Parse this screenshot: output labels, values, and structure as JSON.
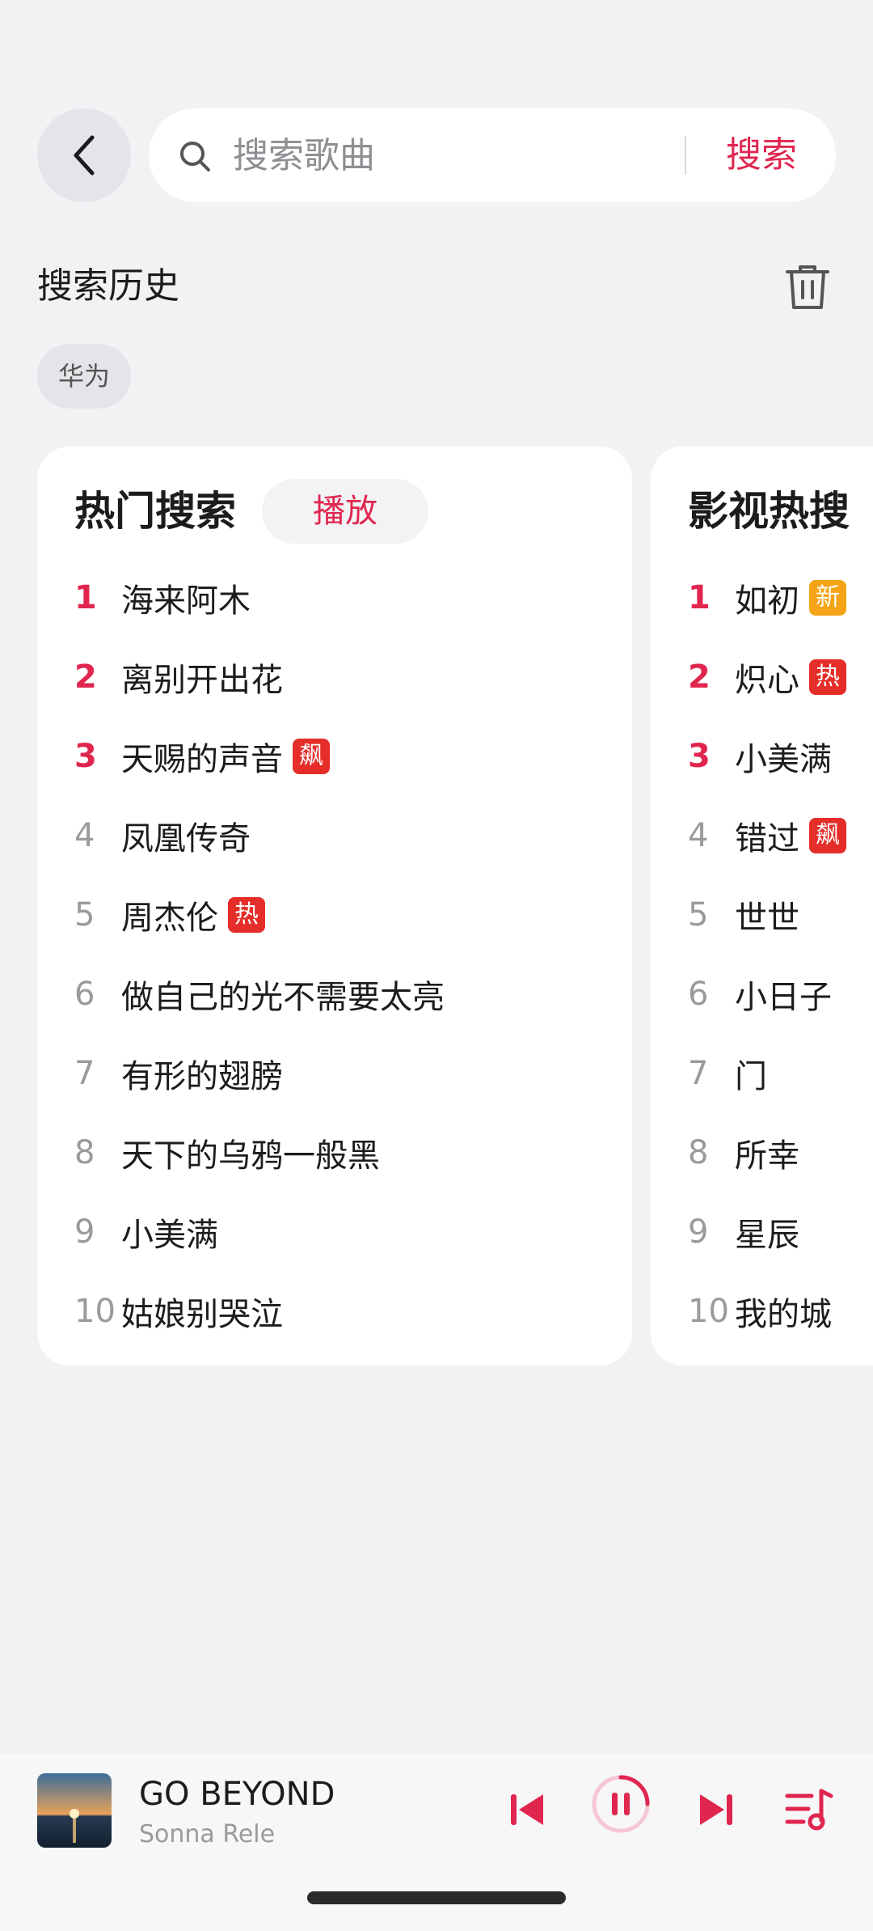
{
  "search": {
    "placeholder": "搜索歌曲",
    "submit_label": "搜索"
  },
  "history": {
    "title": "搜索历史",
    "items": [
      "华为"
    ]
  },
  "hot_search": {
    "title": "热门搜索",
    "play_label": "播放",
    "items": [
      {
        "rank": "1",
        "title": "海来阿木",
        "tag": ""
      },
      {
        "rank": "2",
        "title": "离别开出花",
        "tag": ""
      },
      {
        "rank": "3",
        "title": "天赐的声音",
        "tag": "飙"
      },
      {
        "rank": "4",
        "title": "凤凰传奇",
        "tag": ""
      },
      {
        "rank": "5",
        "title": "周杰伦",
        "tag": "热"
      },
      {
        "rank": "6",
        "title": "做自己的光不需要太亮",
        "tag": ""
      },
      {
        "rank": "7",
        "title": "有形的翅膀",
        "tag": ""
      },
      {
        "rank": "8",
        "title": "天下的乌鸦一般黑",
        "tag": ""
      },
      {
        "rank": "9",
        "title": "小美满",
        "tag": ""
      },
      {
        "rank": "10",
        "title": "姑娘别哭泣",
        "tag": ""
      }
    ]
  },
  "film_search": {
    "title": "影视热搜",
    "items": [
      {
        "rank": "1",
        "title": "如初",
        "tag": "新"
      },
      {
        "rank": "2",
        "title": "炽心",
        "tag": "热"
      },
      {
        "rank": "3",
        "title": "小美满",
        "tag": ""
      },
      {
        "rank": "4",
        "title": "错过",
        "tag": "飙"
      },
      {
        "rank": "5",
        "title": "世世",
        "tag": ""
      },
      {
        "rank": "6",
        "title": "小日子",
        "tag": ""
      },
      {
        "rank": "7",
        "title": "门",
        "tag": ""
      },
      {
        "rank": "8",
        "title": "所幸",
        "tag": ""
      },
      {
        "rank": "9",
        "title": "星辰",
        "tag": ""
      },
      {
        "rank": "10",
        "title": "我的城",
        "tag": ""
      }
    ]
  },
  "player": {
    "song_title": "GO BEYOND",
    "artist": "Sonna Rele"
  },
  "colors": {
    "accent": "#e0264f",
    "tag_red": "#e52e2a",
    "tag_new": "#f4a416",
    "background": "#f1f2f4"
  },
  "icons": {
    "back": "chevron-left-icon",
    "search": "search-icon",
    "trash": "trash-icon",
    "prev": "skip-previous-icon",
    "pause": "pause-icon",
    "next": "skip-next-icon",
    "playlist": "playlist-icon"
  }
}
